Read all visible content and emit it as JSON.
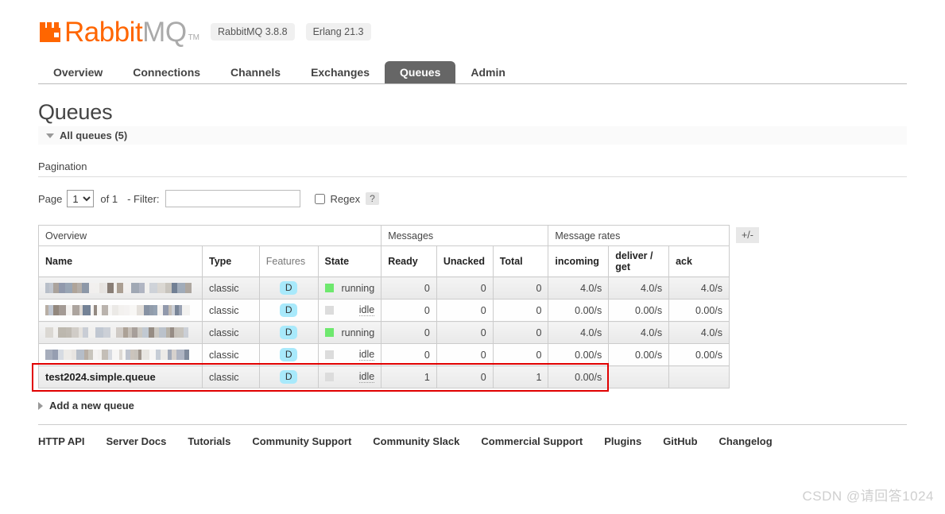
{
  "brand": {
    "name_primary": "Rabbit",
    "name_secondary": "MQ",
    "trademark": "TM",
    "server_version": "RabbitMQ 3.8.8",
    "erlang_version": "Erlang 21.3"
  },
  "nav": {
    "tabs": [
      {
        "label": "Overview",
        "active": false
      },
      {
        "label": "Connections",
        "active": false
      },
      {
        "label": "Channels",
        "active": false
      },
      {
        "label": "Exchanges",
        "active": false
      },
      {
        "label": "Queues",
        "active": true
      },
      {
        "label": "Admin",
        "active": false
      }
    ]
  },
  "page": {
    "title": "Queues",
    "section_header": "All queues (5)",
    "pagination_label": "Pagination",
    "add_queue_label": "Add a new queue"
  },
  "filter": {
    "page_label": "Page",
    "page_value": "1",
    "page_options": [
      "1"
    ],
    "of_label": "of 1",
    "filter_label": "- Filter:",
    "filter_value": "",
    "filter_placeholder": "",
    "regex_label": "Regex",
    "regex_checked": false,
    "help_label": "?"
  },
  "table": {
    "groups": [
      {
        "label": "Overview",
        "span": 4
      },
      {
        "label": "Messages",
        "span": 3
      },
      {
        "label": "Message rates",
        "span": 3
      }
    ],
    "expand_toggle": "+/-",
    "columns": [
      {
        "label": "Name",
        "sortable": true
      },
      {
        "label": "Type",
        "sortable": true
      },
      {
        "label": "Features",
        "sortable": false
      },
      {
        "label": "State",
        "sortable": true
      },
      {
        "label": "Ready",
        "sortable": true
      },
      {
        "label": "Unacked",
        "sortable": true
      },
      {
        "label": "Total",
        "sortable": true
      },
      {
        "label": "incoming",
        "sortable": true
      },
      {
        "label": "deliver / get",
        "sortable": true
      },
      {
        "label": "ack",
        "sortable": true
      }
    ],
    "rows": [
      {
        "name": "",
        "name_redacted": true,
        "type": "classic",
        "features": "D",
        "state": "running",
        "ready": "0",
        "unacked": "0",
        "total": "0",
        "incoming": "4.0/s",
        "deliver_get": "4.0/s",
        "ack": "4.0/s",
        "highlighted": false
      },
      {
        "name": "",
        "name_redacted": true,
        "type": "classic",
        "features": "D",
        "state": "idle",
        "ready": "0",
        "unacked": "0",
        "total": "0",
        "incoming": "0.00/s",
        "deliver_get": "0.00/s",
        "ack": "0.00/s",
        "highlighted": false
      },
      {
        "name": "",
        "name_redacted": true,
        "type": "classic",
        "features": "D",
        "state": "running",
        "ready": "0",
        "unacked": "0",
        "total": "0",
        "incoming": "4.0/s",
        "deliver_get": "4.0/s",
        "ack": "4.0/s",
        "highlighted": false
      },
      {
        "name": "",
        "name_redacted": true,
        "type": "classic",
        "features": "D",
        "state": "idle",
        "ready": "0",
        "unacked": "0",
        "total": "0",
        "incoming": "0.00/s",
        "deliver_get": "0.00/s",
        "ack": "0.00/s",
        "highlighted": false
      },
      {
        "name": "test2024.simple.queue",
        "name_redacted": false,
        "type": "classic",
        "features": "D",
        "state": "idle",
        "ready": "1",
        "unacked": "0",
        "total": "1",
        "incoming": "0.00/s",
        "deliver_get": "",
        "ack": "",
        "highlighted": true
      }
    ]
  },
  "footer": {
    "links": [
      "HTTP API",
      "Server Docs",
      "Tutorials",
      "Community Support",
      "Community Slack",
      "Commercial Support",
      "Plugins",
      "GitHub",
      "Changelog"
    ]
  },
  "watermark": "CSDN @请回答1024",
  "colors": {
    "brand_orange": "#ff6600",
    "active_tab": "#666666",
    "running_green": "#6ee86e",
    "idle_gray": "#dcdcdc",
    "feature_badge": "#a8e9fb",
    "annotation_red": "#e00000"
  }
}
